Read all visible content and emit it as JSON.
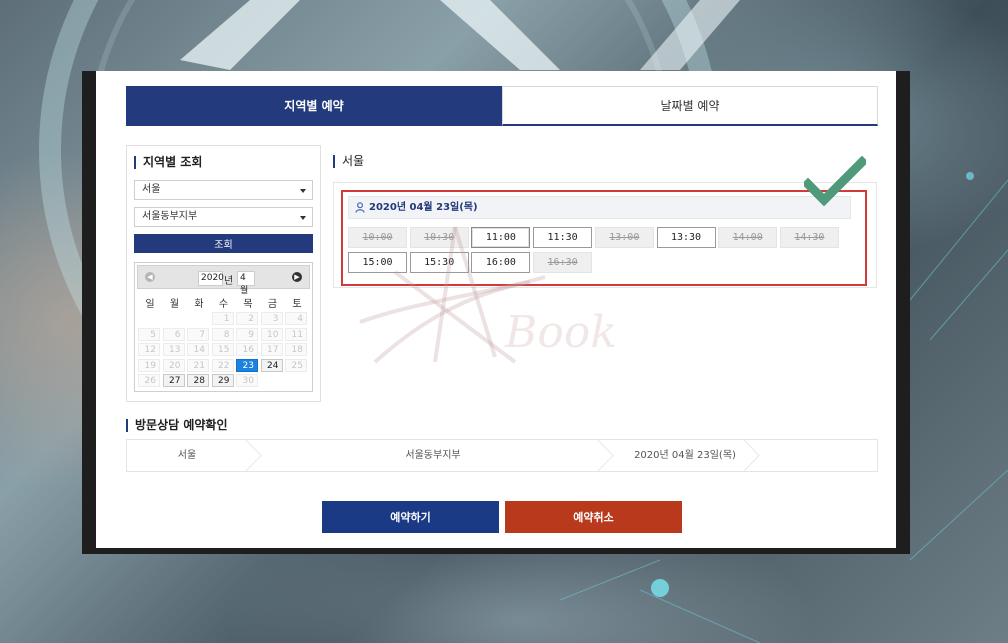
{
  "tabs": {
    "region": "지역별 예약",
    "date": "날짜별 예약"
  },
  "search": {
    "title": "지역별 조회",
    "region_value": "서울",
    "branch_value": "서울동부지부",
    "button_label": "조회"
  },
  "calendar": {
    "year": "2020",
    "year_suffix": "년",
    "month": "4월",
    "weekdays": [
      "일",
      "월",
      "화",
      "수",
      "목",
      "금",
      "토"
    ],
    "weeks": [
      [
        "",
        "",
        "",
        "1",
        "2",
        "3",
        "4"
      ],
      [
        "5",
        "6",
        "7",
        "8",
        "9",
        "10",
        "11"
      ],
      [
        "12",
        "13",
        "14",
        "15",
        "16",
        "17",
        "18"
      ],
      [
        "19",
        "20",
        "21",
        "22",
        "23",
        "24",
        "25"
      ],
      [
        "26",
        "27",
        "28",
        "29",
        "30",
        "",
        ""
      ]
    ],
    "available_days": [
      "24",
      "27",
      "28",
      "29"
    ],
    "selected_day": "23"
  },
  "slots_panel": {
    "title": "서울",
    "date_label": "2020년 04월 23일(목)",
    "slots": [
      {
        "time": "10:00",
        "available": false
      },
      {
        "time": "10:30",
        "available": false
      },
      {
        "time": "11:00",
        "available": true,
        "focused": true
      },
      {
        "time": "11:30",
        "available": true
      },
      {
        "time": "13:00",
        "available": false
      },
      {
        "time": "13:30",
        "available": true
      },
      {
        "time": "14:00",
        "available": false
      },
      {
        "time": "14:30",
        "available": false
      },
      {
        "time": "15:00",
        "available": true
      },
      {
        "time": "15:30",
        "available": true
      },
      {
        "time": "16:00",
        "available": true
      },
      {
        "time": "16:30",
        "available": false
      }
    ]
  },
  "confirm": {
    "title": "방문상담 예약확인",
    "region": "서울",
    "branch": "서울동부지부",
    "date": "2020년 04월 23일(목)"
  },
  "actions": {
    "reserve": "예약하기",
    "cancel": "예약취소"
  },
  "watermark_text": "Book",
  "colors": {
    "primary": "#233a7d",
    "selected_day": "#1a82e0",
    "cancel": "#b8391c",
    "highlight": "#d23a3a",
    "checkmark": "#4f9a7a"
  }
}
